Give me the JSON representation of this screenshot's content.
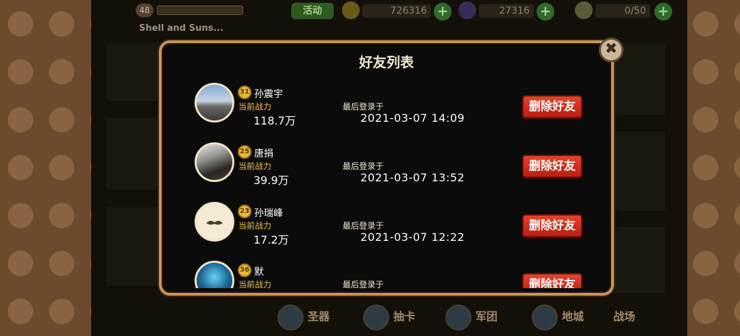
{
  "hud": {
    "level": "48",
    "guild_name": "Shell and Suns...",
    "event_label": "活动",
    "gold": "726316",
    "gems": "27316",
    "capacity": "0/50"
  },
  "modal": {
    "title": "好友列表",
    "power_label": "当前战力",
    "login_label": "最后登录于",
    "delete_label": "删除好友",
    "close_glyph": "✖"
  },
  "friends": [
    {
      "level": "31",
      "name": "孙震宇",
      "power": "118.7万",
      "last_login": "2021-03-07 14:09"
    },
    {
      "level": "25",
      "name": "唐捐",
      "power": "39.9万",
      "last_login": "2021-03-07 13:52"
    },
    {
      "level": "23",
      "name": "孙瑞峰",
      "power": "17.2万",
      "last_login": "2021-03-07 12:22"
    },
    {
      "level": "36",
      "name": "默",
      "power": "",
      "last_login": ""
    }
  ],
  "bottom_nav": {
    "item1": "圣器",
    "item2": "抽卡",
    "item3": "军团",
    "item4": "地城",
    "item5": "战场"
  },
  "colors": {
    "modal_border": "#c9965a",
    "delete_button": "#d03020",
    "power_label": "#f2c24a",
    "level_badge": "#e7b93a"
  }
}
